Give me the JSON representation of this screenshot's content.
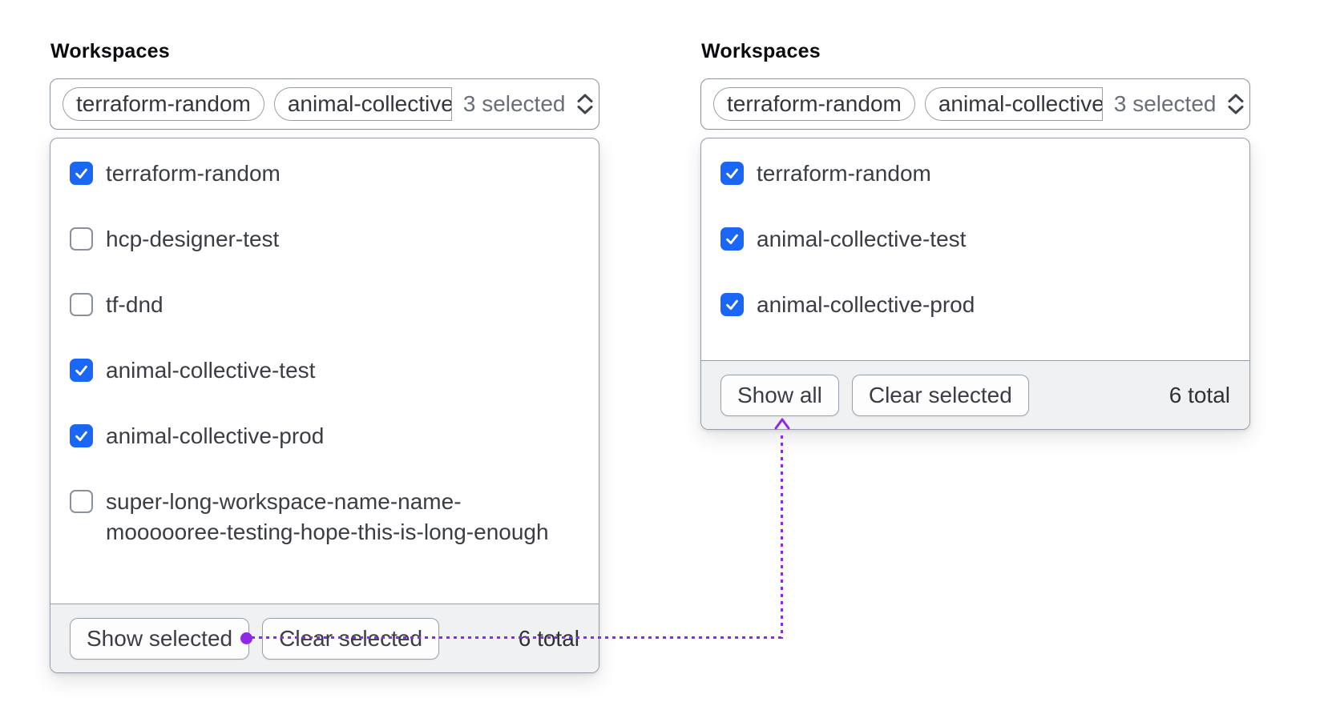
{
  "colors": {
    "accent-blue": "#1a66f6",
    "connector-purple": "#8d2ae6"
  },
  "left_panel": {
    "label": "Workspaces",
    "trigger": {
      "pills": [
        "terraform-random",
        "animal-collective"
      ],
      "count_text": "3 selected",
      "icon": "caret-sort-icon"
    },
    "items": [
      {
        "label": "terraform-random",
        "checked": true
      },
      {
        "label": "hcp-designer-test",
        "checked": false
      },
      {
        "label": "tf-dnd",
        "checked": false
      },
      {
        "label": "animal-collective-test",
        "checked": true
      },
      {
        "label": "animal-collective-prod",
        "checked": true
      },
      {
        "label": "super-long-workspace-name-name-moooooree-testing-hope-this-is-long-enough",
        "checked": false
      }
    ],
    "footer": {
      "primary_button": "Show selected",
      "secondary_button": "Clear selected",
      "total_text": "6 total"
    }
  },
  "right_panel": {
    "label": "Workspaces",
    "trigger": {
      "pills": [
        "terraform-random",
        "animal-collective"
      ],
      "count_text": "3 selected",
      "icon": "caret-sort-icon"
    },
    "items": [
      {
        "label": "terraform-random",
        "checked": true
      },
      {
        "label": "animal-collective-test",
        "checked": true
      },
      {
        "label": "animal-collective-prod",
        "checked": true
      }
    ],
    "footer": {
      "primary_button": "Show all",
      "secondary_button": "Clear selected",
      "total_text": "6 total"
    }
  },
  "annotation_arrow": {
    "style": "dotted",
    "from": "Show selected",
    "to": "Show all"
  }
}
